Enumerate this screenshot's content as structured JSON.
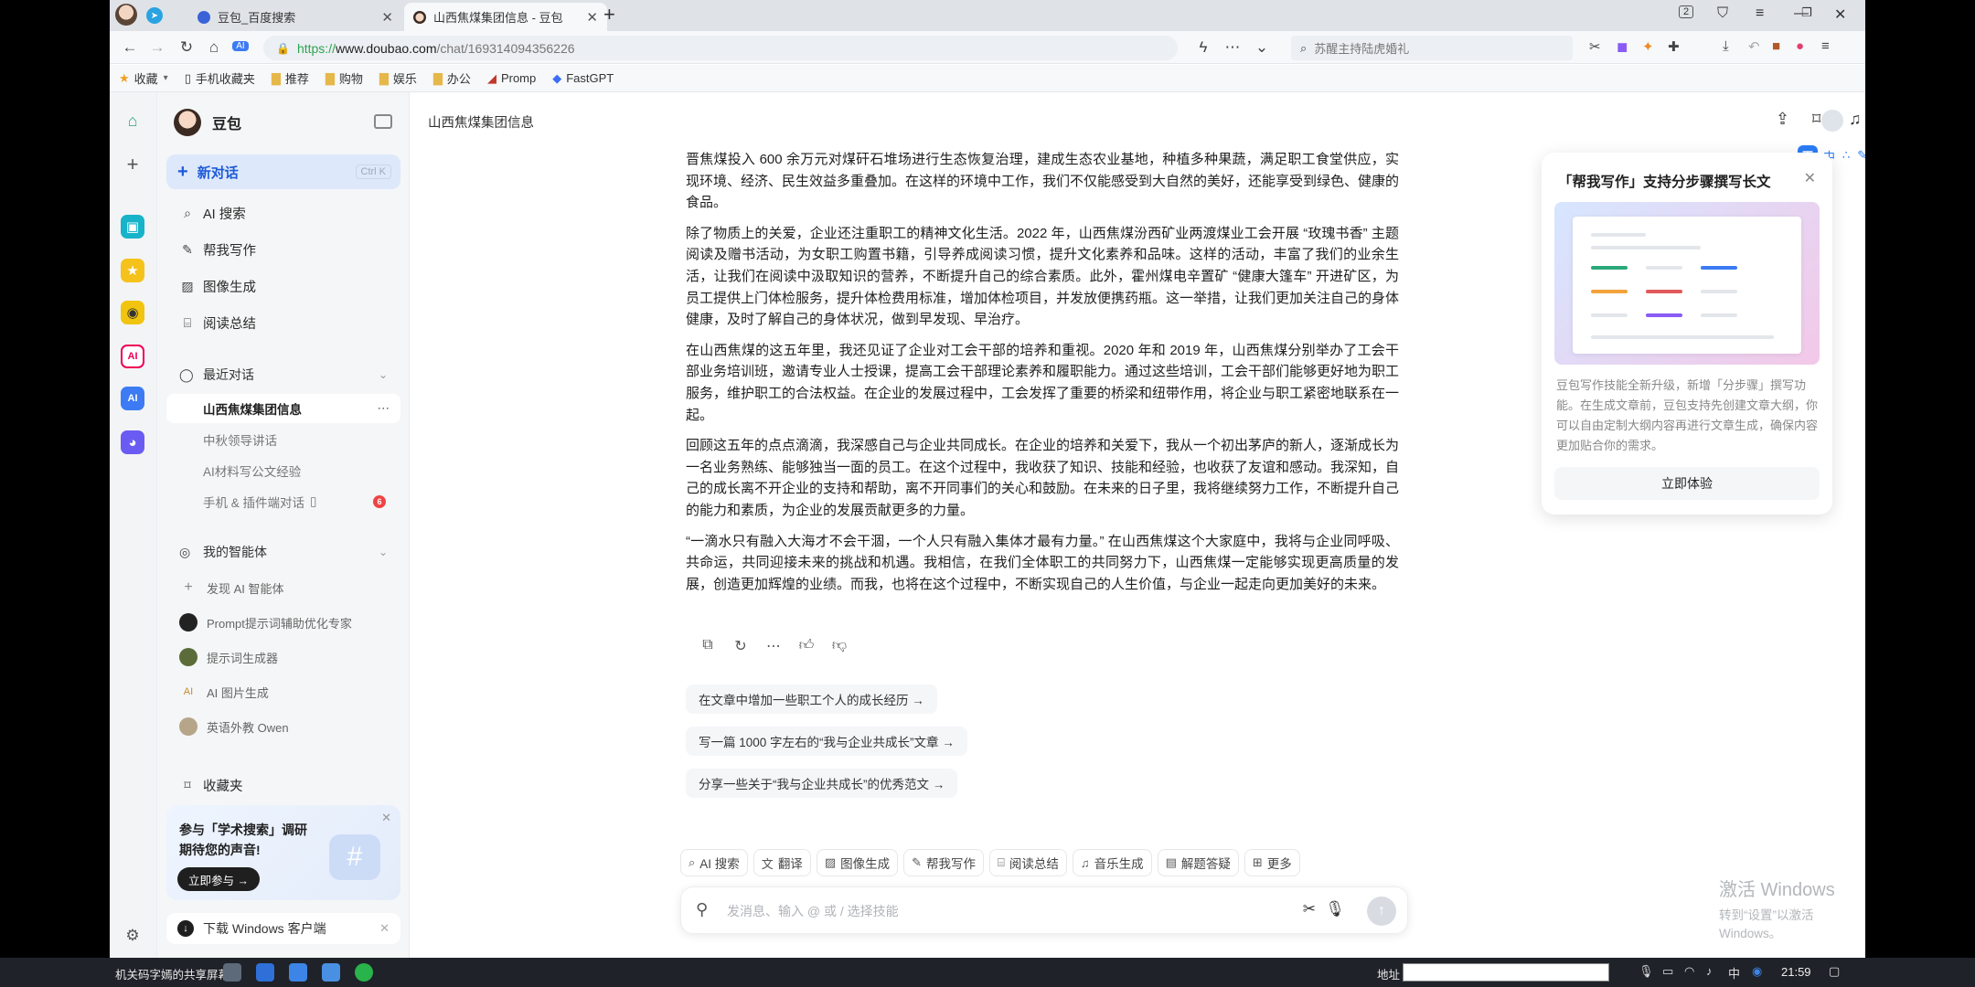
{
  "browser": {
    "tabs": [
      {
        "label": "豆包_百度搜索",
        "active": false
      },
      {
        "label": "山西焦煤集团信息 - 豆包",
        "active": true
      }
    ],
    "new_tab": "+",
    "url": {
      "scheme": "https://",
      "host": "www.doubao.com",
      "path": "/chat/169314094356226"
    },
    "search_placeholder": "苏醒主持陆虎婚礼",
    "tab_counter": "2",
    "bookmarks": [
      "收藏",
      "手机收藏夹",
      "推荐",
      "购物",
      "娱乐",
      "办公",
      "Promp",
      "FastGPT"
    ]
  },
  "sidebar": {
    "brand": "豆包",
    "new_chat": "新对话",
    "new_chat_shortcut": "Ctrl K",
    "nav": [
      "AI 搜索",
      "帮我写作",
      "图像生成",
      "阅读总结"
    ],
    "recent_header": "最近对话",
    "recent": [
      {
        "label": "山西焦煤集团信息",
        "active": true
      },
      {
        "label": "中秋领导讲话",
        "active": false
      },
      {
        "label": "AI材料写公文经验",
        "active": false
      },
      {
        "label": "手机 & 插件端对话",
        "active": false,
        "badge": "6"
      }
    ],
    "agents_header": "我的智能体",
    "agents": [
      "发现 AI 智能体",
      "Prompt提示词辅助优化专家",
      "提示词生成器",
      "AI 图片生成",
      "英语外教 Owen"
    ],
    "favorites": "收藏夹",
    "promo": {
      "line1": "参与「学术搜索」调研",
      "line2": "期待您的声音!",
      "button": "立即参与 →"
    },
    "download": "下载 Windows 客户端"
  },
  "main": {
    "page_title": "山西焦煤集团信息",
    "paragraphs": [
      "晋焦煤投入 600 余万元对煤矸石堆场进行生态恢复治理，建成生态农业基地，种植多种果蔬，满足职工食堂供应，实现环境、经济、民生效益多重叠加。在这样的环境中工作，我们不仅能感受到大自然的美好，还能享受到绿色、健康的食品。",
      "除了物质上的关爱，企业还注重职工的精神文化生活。2022 年，山西焦煤汾西矿业两渡煤业工会开展 “玫瑰书香” 主题阅读及赠书活动，为女职工购置书籍，引导养成阅读习惯，提升文化素养和品味。这样的活动，丰富了我们的业余生活，让我们在阅读中汲取知识的营养，不断提升自己的综合素质。此外，霍州煤电辛置矿 “健康大篷车” 开进矿区，为员工提供上门体检服务，提升体检费用标准，增加体检项目，并发放便携药瓶。这一举措，让我们更加关注自己的身体健康，及时了解自己的身体状况，做到早发现、早治疗。",
      "在山西焦煤的这五年里，我还见证了企业对工会干部的培养和重视。2020 年和 2019 年，山西焦煤分别举办了工会干部业务培训班，邀请专业人士授课，提高工会干部理论素养和履职能力。通过这些培训，工会干部们能够更好地为职工服务，维护职工的合法权益。在企业的发展过程中，工会发挥了重要的桥梁和纽带作用，将企业与职工紧密地联系在一起。",
      "回顾这五年的点点滴滴，我深感自己与企业共同成长。在企业的培养和关爱下，我从一个初出茅庐的新人，逐渐成长为一名业务熟练、能够独当一面的员工。在这个过程中，我收获了知识、技能和经验，也收获了友谊和感动。我深知，自己的成长离不开企业的支持和帮助，离不开同事们的关心和鼓励。在未来的日子里，我将继续努力工作，不断提升自己的能力和素质，为企业的发展贡献更多的力量。",
      "“一滴水只有融入大海才不会干涸，一个人只有融入集体才最有力量。” 在山西焦煤这个大家庭中，我将与企业同呼吸、共命运，共同迎接未来的挑战和机遇。我相信，在我们全体职工的共同努力下，山西焦煤一定能够实现更高质量的发展，创造更加辉煌的业绩。而我，也将在这个过程中，不断实现自己的人生价值，与企业一起走向更加美好的未来。"
    ],
    "suggestions": [
      "在文章中增加一些职工个人的成长经历 →",
      "写一篇 1000 字左右的“我与企业共成长”文章 →",
      "分享一些关于“我与企业共成长”的优秀范文 →"
    ],
    "features": [
      "AI 搜索",
      "翻译",
      "图像生成",
      "帮我写作",
      "阅读总结",
      "音乐生成",
      "解题答疑",
      "更多"
    ],
    "input_placeholder": "发消息、输入 @ 或 / 选择技能",
    "float_card": {
      "title": "「帮我写作」支持分步骤撰写长文",
      "desc": "豆包写作技能全新升级，新增「分步骤」撰写功能。在生成文章前，豆包支持先创建文章大纲，你可以自由定制大纲内容再进行文章生成，确保内容更加贴合你的需求。",
      "button": "立即体验"
    },
    "toolstrip_label": "中",
    "watermark": {
      "line1": "激活 Windows",
      "line2": "转到“设置”以激活 Windows。"
    }
  },
  "taskbar": {
    "share_label": "机关码字嫣的共享屏幕",
    "addr_label": "地址",
    "ime": "中",
    "clock": "21:59"
  }
}
